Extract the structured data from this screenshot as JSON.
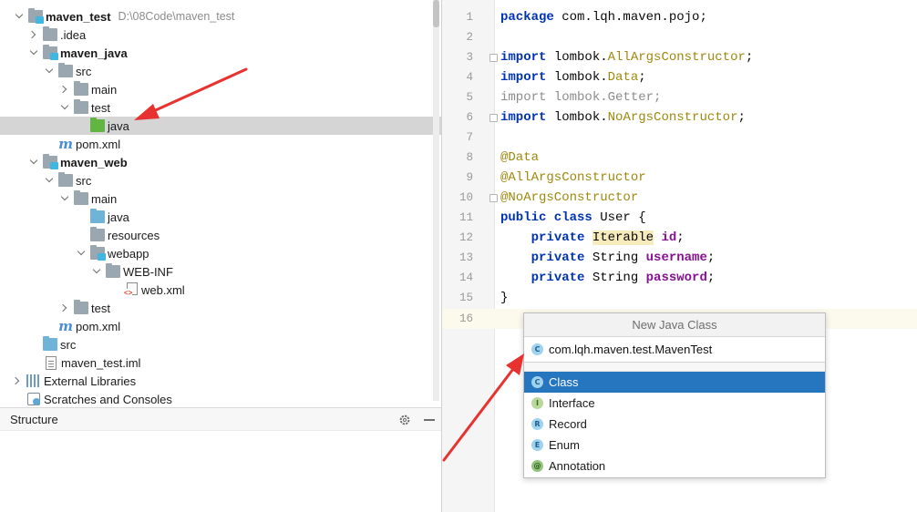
{
  "project_tree": {
    "rows": [
      {
        "label": "maven_test",
        "hint": "D:\\08Code\\maven_test",
        "bold": true
      },
      {
        "label": ".idea"
      },
      {
        "label": "maven_java",
        "bold": true
      },
      {
        "label": "src"
      },
      {
        "label": "main"
      },
      {
        "label": "test"
      },
      {
        "label": "java"
      },
      {
        "label": "pom.xml"
      },
      {
        "label": "maven_web",
        "bold": true
      },
      {
        "label": "src"
      },
      {
        "label": "main"
      },
      {
        "label": "java"
      },
      {
        "label": "resources"
      },
      {
        "label": "webapp"
      },
      {
        "label": "WEB-INF"
      },
      {
        "label": "web.xml"
      },
      {
        "label": "test"
      },
      {
        "label": "pom.xml"
      },
      {
        "label": "src"
      },
      {
        "label": "maven_test.iml"
      },
      {
        "label": "External Libraries"
      },
      {
        "label": "Scratches and Consoles"
      }
    ]
  },
  "structure_panel": {
    "title": "Structure"
  },
  "editor": {
    "line_numbers": [
      "1",
      "2",
      "3",
      "4",
      "5",
      "6",
      "7",
      "8",
      "9",
      "10",
      "11",
      "12",
      "13",
      "14",
      "15",
      "16"
    ],
    "code": {
      "l1_kw": "package",
      "l1_rest": " com.lqh.maven.pojo;",
      "l3_kw": "import",
      "l3_pkg": " lombok.",
      "l3_cls": "AllArgsConstructor",
      "l3_end": ";",
      "l4_kw": "import",
      "l4_pkg": " lombok.",
      "l4_cls": "Data",
      "l4_end": ";",
      "l5_text": "import lombok.Getter;",
      "l6_kw": "import",
      "l6_pkg": " lombok.",
      "l6_cls": "NoArgsConstructor",
      "l6_end": ";",
      "l8": "@Data",
      "l9": "@AllArgsConstructor",
      "l10": "@NoArgsConstructor",
      "l11_kw": "public class",
      "l11_rest": " User {",
      "l12_kw": "private",
      "l12_type": "Iterable",
      "l12_field": "id",
      "l12_end": ";",
      "l13_kw": "private",
      "l13_type": " String ",
      "l13_field": "username",
      "l13_end": ";",
      "l14_kw": "private",
      "l14_type": " String ",
      "l14_field": "password",
      "l14_end": ";",
      "l15": "}"
    }
  },
  "new_class_popup": {
    "title": "New Java Class",
    "input_value": "com.lqh.maven.test.MavenTest",
    "kinds": [
      {
        "badge": "C",
        "label": "Class",
        "selected": true
      },
      {
        "badge": "I",
        "label": "Interface"
      },
      {
        "badge": "R",
        "label": "Record"
      },
      {
        "badge": "E",
        "label": "Enum"
      },
      {
        "badge": "@",
        "label": "Annotation"
      }
    ]
  },
  "colors": {
    "selection": "#2675bf",
    "keyword": "#0033b3",
    "annotation": "#9e880d",
    "field": "#871094",
    "arrow": "#e8322f"
  }
}
